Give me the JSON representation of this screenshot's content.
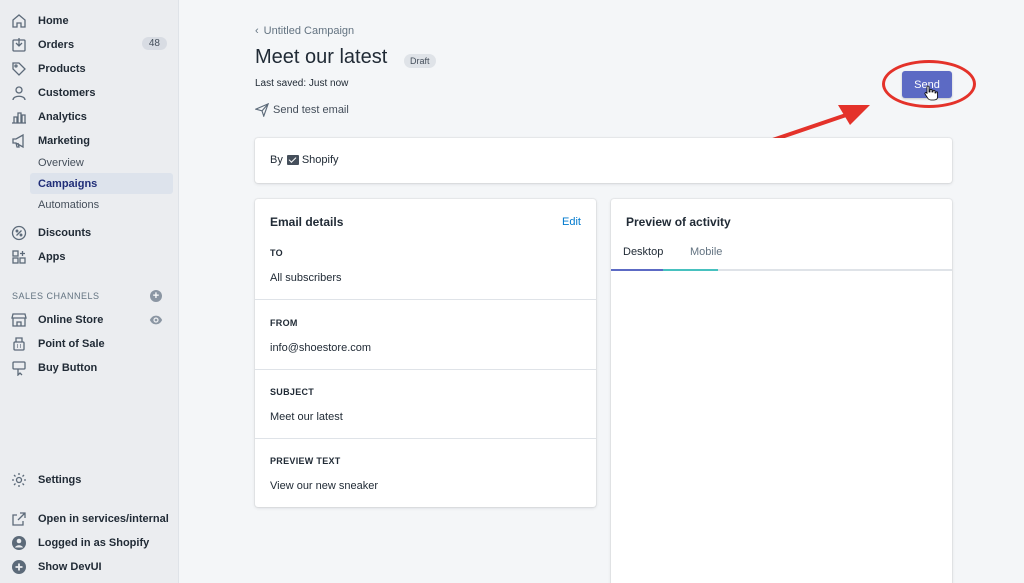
{
  "sidebar": {
    "items": [
      {
        "label": "Home",
        "icon": "home-icon"
      },
      {
        "label": "Orders",
        "icon": "orders-icon",
        "badge": "48"
      },
      {
        "label": "Products",
        "icon": "tag-icon"
      },
      {
        "label": "Customers",
        "icon": "person-icon"
      },
      {
        "label": "Analytics",
        "icon": "bar-chart-icon"
      },
      {
        "label": "Marketing",
        "icon": "megaphone-icon"
      }
    ],
    "marketing_sub": [
      "Overview",
      "Campaigns",
      "Automations"
    ],
    "more_items": [
      {
        "label": "Discounts",
        "icon": "discount-icon"
      },
      {
        "label": "Apps",
        "icon": "apps-icon"
      }
    ],
    "sales_channels_heading": "SALES CHANNELS",
    "channels": [
      {
        "label": "Online Store",
        "icon": "store-icon"
      },
      {
        "label": "Point of Sale",
        "icon": "pos-icon"
      },
      {
        "label": "Buy Button",
        "icon": "buy-button-icon"
      }
    ],
    "settings": "Settings",
    "bottom": [
      {
        "label": "Open in services/internal",
        "icon": "external-link-icon"
      },
      {
        "label": "Logged in as Shopify",
        "icon": "user-circle-icon"
      },
      {
        "label": "Show DevUI",
        "icon": "plus-circle-icon"
      }
    ]
  },
  "header": {
    "breadcrumb": "Untitled Campaign",
    "title": "Meet our latest",
    "status": "Draft",
    "last_saved": "Last saved: Just now",
    "send_test": "Send test email",
    "send_button": "Send"
  },
  "by_card": {
    "prefix": "By",
    "brand": "Shopify"
  },
  "email_details": {
    "title": "Email details",
    "edit": "Edit",
    "sections": [
      {
        "label": "TO",
        "value": "All subscribers"
      },
      {
        "label": "FROM",
        "value": "info@shoestore.com"
      },
      {
        "label": "SUBJECT",
        "value": "Meet our latest"
      },
      {
        "label": "PREVIEW TEXT",
        "value": "View our new sneaker"
      }
    ]
  },
  "preview": {
    "title": "Preview of activity",
    "tabs": [
      "Desktop",
      "Mobile"
    ]
  },
  "colors": {
    "accent": "#5c6ac4",
    "annotation": "#e4322a",
    "link": "#007ace"
  }
}
